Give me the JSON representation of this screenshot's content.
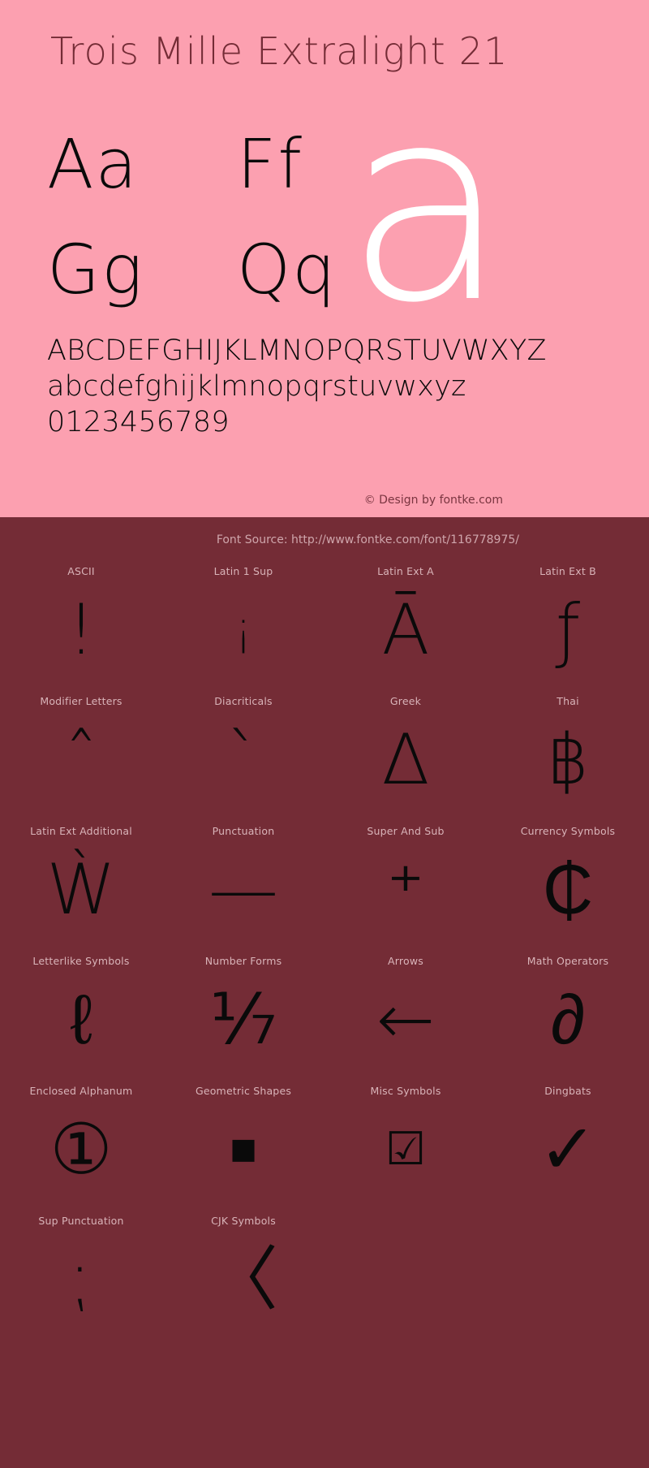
{
  "specimen": {
    "title": "Trois Mille Extralight 21",
    "letter_pairs": [
      "Aa",
      "Ff",
      "Gg",
      "Qq"
    ],
    "hero_glyph": "a",
    "uppercase": "ABCDEFGHIJKLMNOPQRSTUVWXYZ",
    "lowercase": "abcdefghijklmnopqrstuvwxyz",
    "digits": "0123456789",
    "copyright": "© Design by fontke.com",
    "source": "Font Source: http://www.fontke.com/font/116778975/",
    "colors": {
      "panel_background": "#fca0b0",
      "blocks_background": "#742c36",
      "title": "#742c36",
      "glyph": "#0a0a0a",
      "hero_glyph": "#ffffff",
      "label": "#d9b4b9"
    }
  },
  "unicode_blocks": [
    {
      "label": "ASCII",
      "glyph": "!",
      "size": "tall"
    },
    {
      "label": "Latin 1 Sup",
      "glyph": "¡",
      "size": "small"
    },
    {
      "label": "Latin Ext A",
      "glyph": "Ā",
      "size": "tall"
    },
    {
      "label": "Latin Ext B",
      "glyph": "ƒ",
      "size": "tall"
    },
    {
      "label": "Modifier Letters",
      "glyph": "ˆ",
      "size": "tall"
    },
    {
      "label": "Diacriticals",
      "glyph": "ˋ",
      "size": "tall"
    },
    {
      "label": "Greek",
      "glyph": "Δ",
      "size": "tall"
    },
    {
      "label": "Thai",
      "glyph": "฿",
      "size": "tall"
    },
    {
      "label": "Latin Ext Additional",
      "glyph": "Ẁ",
      "size": "tall"
    },
    {
      "label": "Punctuation",
      "glyph": "—",
      "size": "tall"
    },
    {
      "label": "Super And Sub",
      "glyph": "⁺",
      "size": "tall"
    },
    {
      "label": "Currency Symbols",
      "glyph": "₵",
      "size": "tall"
    },
    {
      "label": "Letterlike Symbols",
      "glyph": "ℓ",
      "size": "tall"
    },
    {
      "label": "Number Forms",
      "glyph": "⅐",
      "size": "tall"
    },
    {
      "label": "Arrows",
      "glyph": "←",
      "size": "tall"
    },
    {
      "label": "Math Operators",
      "glyph": "∂",
      "size": "tall"
    },
    {
      "label": "Enclosed Alphanum",
      "glyph": "①",
      "size": "tall"
    },
    {
      "label": "Geometric Shapes",
      "glyph": "■",
      "size": "small"
    },
    {
      "label": "Misc Symbols",
      "glyph": "☑",
      "size": "small"
    },
    {
      "label": "Dingbats",
      "glyph": "✓",
      "size": "tall"
    },
    {
      "label": "Sup Punctuation",
      "glyph": "⁏",
      "size": "tall"
    },
    {
      "label": "CJK Symbols",
      "glyph": "〈",
      "size": "tall"
    }
  ]
}
